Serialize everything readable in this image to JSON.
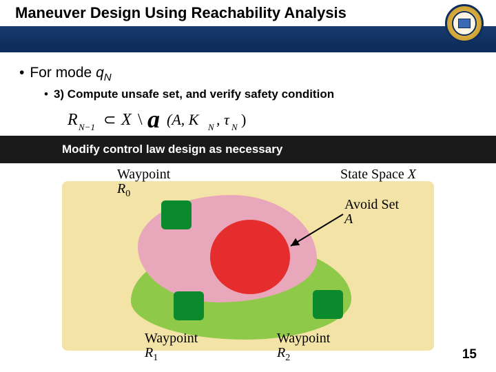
{
  "title": "Maneuver Design Using Reachability Analysis",
  "bullet1_prefix": "For mode ",
  "bullet1_var": "q",
  "bullet1_sub": "N",
  "bullet2": "3) Compute unsafe set, and verify safety condition",
  "formula": {
    "lhs_R": "R",
    "lhs_sub": "N−1",
    "subset": "⊂",
    "X": "X",
    "setminus": "\\",
    "a": "a",
    "args": "(A, K",
    "argsub": "N",
    "args2": ", τ",
    "argsub2": "N",
    "close": ")"
  },
  "darkbar": "Modify control law design as necessary",
  "labels": {
    "wp0_a": "Waypoint",
    "wp0_b": "R",
    "wp0_c": "0",
    "ss_a": "State Space ",
    "ss_b": "X",
    "avoid_a": "Avoid Set",
    "avoid_b": "A",
    "wp1_a": "Waypoint",
    "wp1_b": "R",
    "wp1_c": "1",
    "wp2_a": "Waypoint",
    "wp2_b": "R",
    "wp2_c": "2"
  },
  "page": "15"
}
